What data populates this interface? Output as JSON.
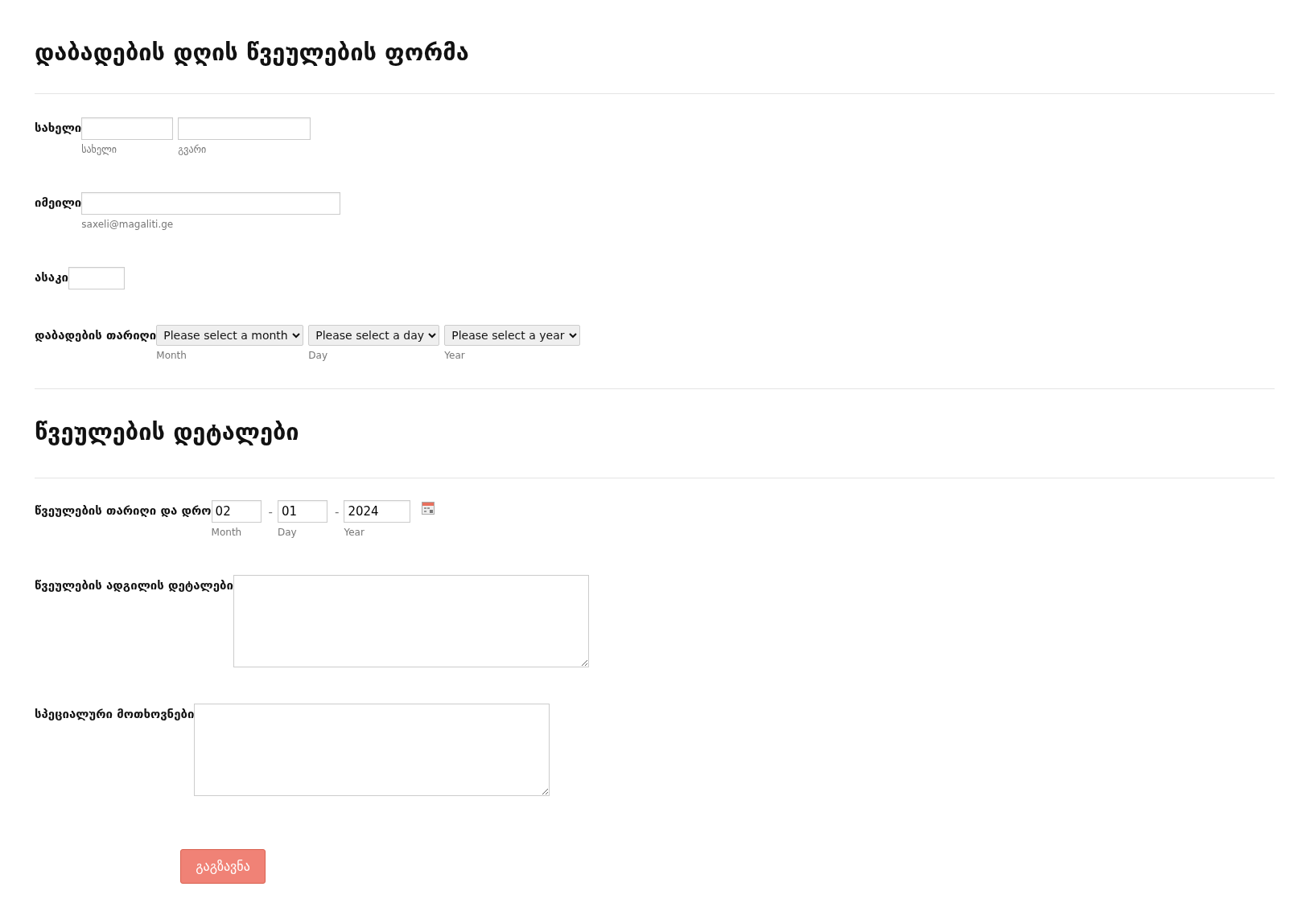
{
  "sections": [
    {
      "heading": "დაბადების დღის წვეულების ფორმა",
      "fields": [
        {
          "kind": "name",
          "label": "სახელი",
          "inputs": [
            {
              "sublabel": "სახელი"
            },
            {
              "sublabel": "გვარი"
            }
          ]
        },
        {
          "kind": "email",
          "label": "იმეილი",
          "inputs": [
            {
              "sublabel": "saxeli@magaliti.ge"
            }
          ]
        },
        {
          "kind": "number",
          "label": "ასაკი"
        },
        {
          "kind": "selects",
          "label": "დაბადების თარიღი",
          "inputs": [
            {
              "value": "Please select a month",
              "sublabel": "Month"
            },
            {
              "value": "Please select a day",
              "sublabel": "Day"
            },
            {
              "value": "Please select a year",
              "sublabel": "Year"
            }
          ]
        }
      ]
    },
    {
      "heading": "წვეულების დეტალები",
      "fields": [
        {
          "kind": "date",
          "label": "წვეულების თარიღი და დრო",
          "inputs": [
            {
              "value": "02",
              "sublabel": "Month"
            },
            {
              "separator": "-"
            },
            {
              "value": "01",
              "sublabel": "Day"
            },
            {
              "separator": "-"
            },
            {
              "value": "2024",
              "sublabel": "Year"
            }
          ]
        },
        {
          "kind": "textarea",
          "label": "წვეულების ადგილის დეტალები"
        },
        {
          "kind": "textarea",
          "label": "სპეციალური მოთხოვნები"
        }
      ]
    }
  ],
  "submit": "გაგზავნა"
}
